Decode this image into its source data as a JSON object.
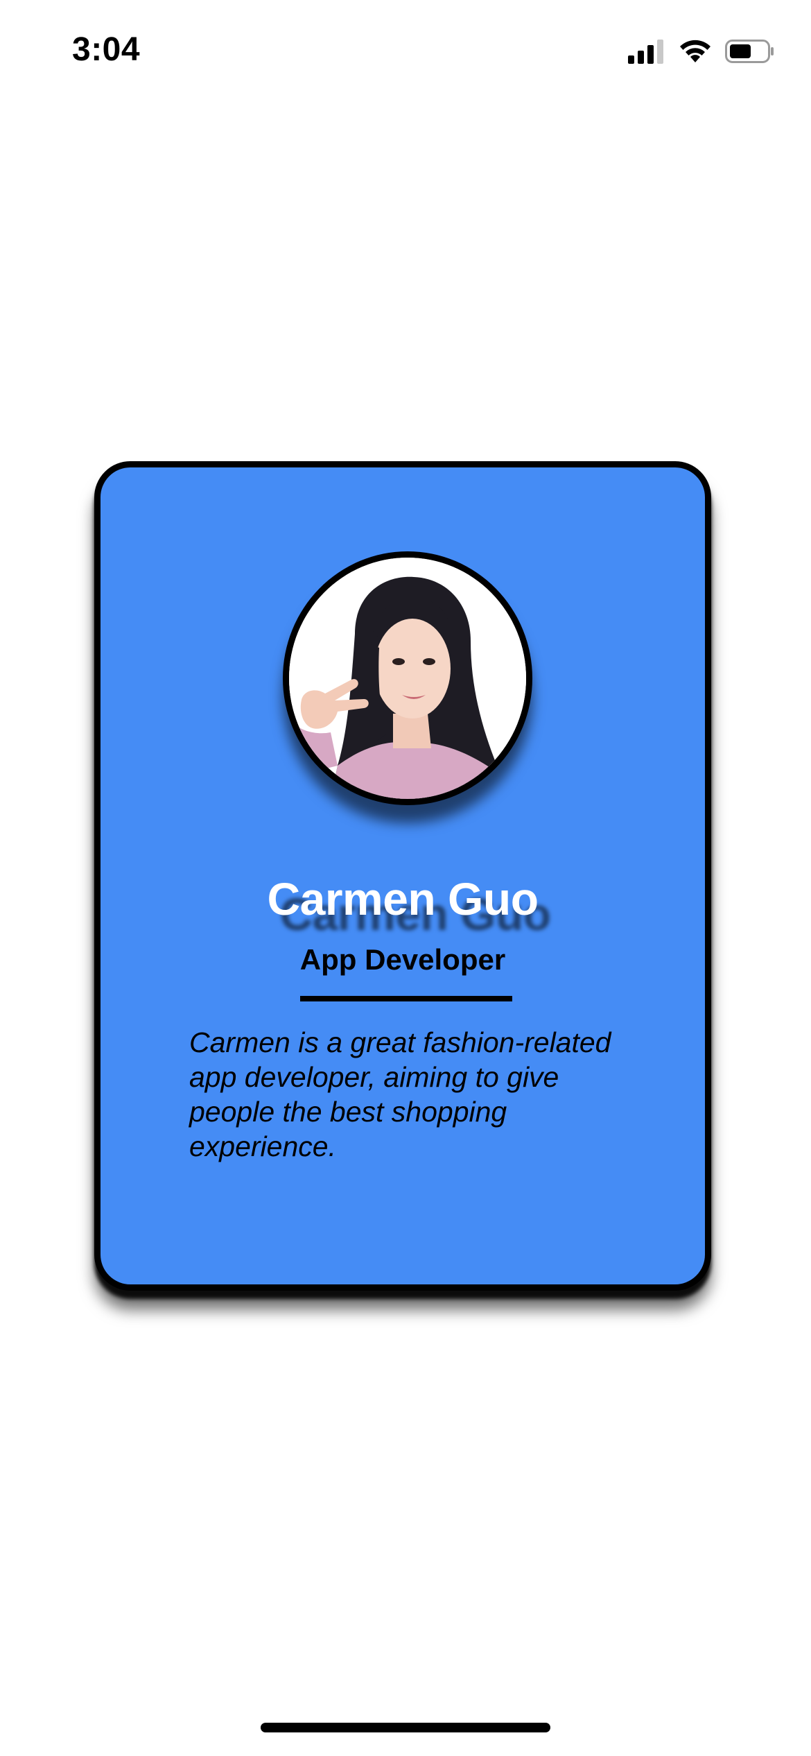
{
  "status_bar": {
    "time": "3:04",
    "icons": [
      "cellular-signal-icon",
      "wifi-icon",
      "battery-icon"
    ]
  },
  "card": {
    "background_color": "#458cf5",
    "border_color": "#000000",
    "avatar": {
      "description_icon": "profile-photo"
    },
    "name": "Carmen Guo",
    "role": "App Developer",
    "bio": "Carmen is a great fashion-related app developer, aiming to give people the best shopping experience."
  }
}
